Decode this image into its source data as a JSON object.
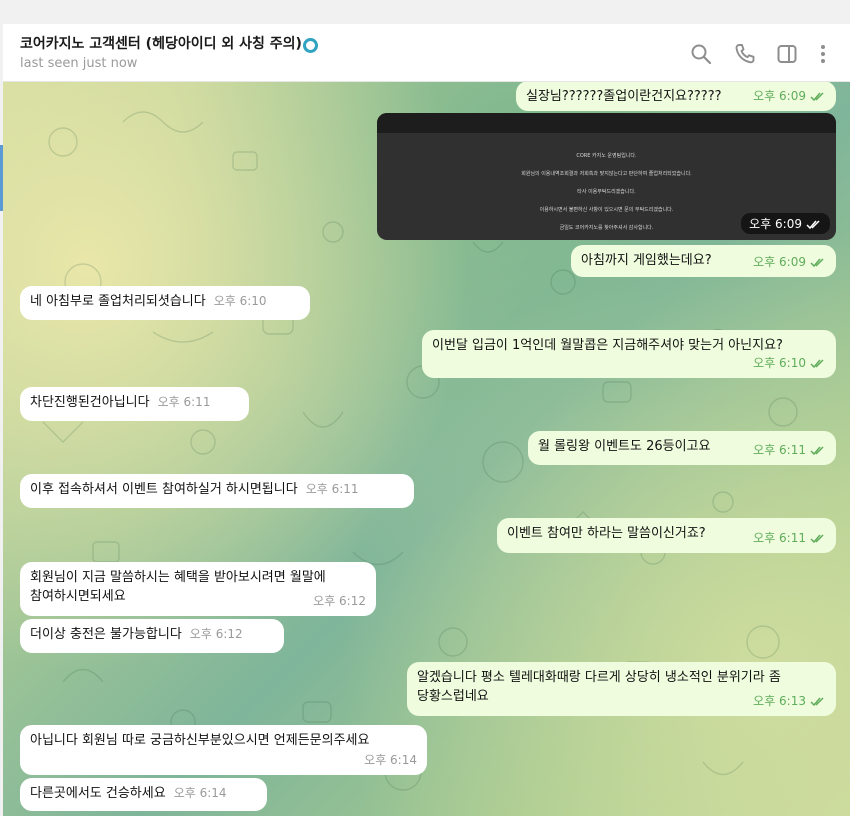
{
  "header": {
    "title": "코어카지노 고객센터 (헤당아이디 외 사칭 주의)",
    "status": "last seen just now",
    "icons": [
      "search-icon",
      "phone-icon",
      "sidebar-icon",
      "more-icon"
    ]
  },
  "image_message": {
    "lines": [
      "CORE 카지노 운영팀입니다.",
      "회원님의 이용내역조회결과 저희측과 맞지않는다고 판단하여 졸업처리되었습니다.",
      "타사 이용부탁드리겠습니다.",
      "이용하시면서 불편하신 사항이 있으시면 문의 부탁드리겠습니다.",
      "금일도 코어카지노를 찾아주셔서 감사합니다."
    ],
    "time": "오후 6:09"
  },
  "messages": [
    {
      "text": "실장님??????졸업이란건지요?????",
      "time": "오후 6:09"
    },
    {
      "text": "아침까지 게임했는데요?",
      "time": "오후 6:09"
    },
    {
      "text": "네 아침부로 졸업처리되셧습니다",
      "time": "오후 6:10"
    },
    {
      "text": "이번달 입금이 1억인데 월말콥은 지금해주셔야 맞는거 아닌지요?",
      "time": "오후 6:10"
    },
    {
      "text": "차단진행된건아닙니다",
      "time": "오후 6:11"
    },
    {
      "text": "월 롤링왕 이벤트도 26등이고요",
      "time": "오후 6:11"
    },
    {
      "text": "이후 접속하셔서 이벤트 참여하실거 하시면됩니다",
      "time": "오후 6:11"
    },
    {
      "text": "이벤트 참여만 하라는 말씀이신거죠?",
      "time": "오후 6:11"
    },
    {
      "line1": "회원님이 지금 말씀하시는 혜택을 받아보시려면 월말에",
      "line2": "참여하시면되세요",
      "time": "오후 6:12"
    },
    {
      "text": "더이상 충전은 불가능합니다",
      "time": "오후 6:12"
    },
    {
      "line1": "알겠습니다 평소 텔레대화때랑 다르게 상당히 냉소적인 분위기라 좀",
      "line2": "당황스럽네요",
      "time": "오후 6:13"
    },
    {
      "text": "아닙니다 회원님 따로 궁금하신부분있으시면 언제든문의주세요",
      "time": "오후 6:14"
    },
    {
      "text": "다른곳에서도 건승하세요",
      "time": "오후 6:14"
    }
  ]
}
